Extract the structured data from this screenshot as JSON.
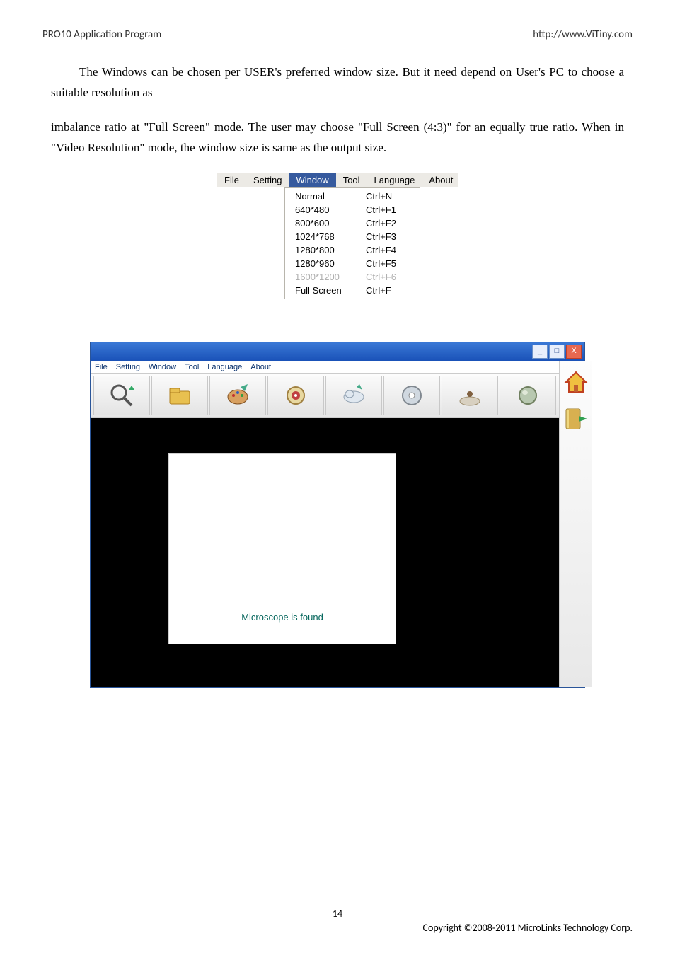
{
  "header": {
    "left": "PRO10 Application Program",
    "right": "http://www.ViTiny.com"
  },
  "para1": "The Windows can be chosen per USER's preferred window size. But it need depend on User's PC to choose a suitable resolution as",
  "para2": "imbalance ratio at \"Full Screen\" mode.   The user may choose \"Full Screen (4:3)\" for an equally true ratio.  When in \"Video Resolution\" mode, the window size is same as the output size.",
  "menubar": [
    "File",
    "Setting",
    "Window",
    "Tool",
    "Language",
    "About"
  ],
  "menubar_selected": "Window",
  "dropdown": [
    {
      "label": "Normal",
      "shortcut": "Ctrl+N",
      "disabled": false
    },
    {
      "label": "640*480",
      "shortcut": "Ctrl+F1",
      "disabled": false
    },
    {
      "label": "800*600",
      "shortcut": "Ctrl+F2",
      "disabled": false
    },
    {
      "label": "1024*768",
      "shortcut": "Ctrl+F3",
      "disabled": false
    },
    {
      "label": "1280*800",
      "shortcut": "Ctrl+F4",
      "disabled": false
    },
    {
      "label": "1280*960",
      "shortcut": "Ctrl+F5",
      "disabled": false
    },
    {
      "label": "1600*1200",
      "shortcut": "Ctrl+F6",
      "disabled": true
    },
    {
      "label": "Full Screen",
      "shortcut": "Ctrl+F",
      "disabled": false
    }
  ],
  "app_menubar": [
    "File",
    "Setting",
    "Window",
    "Tool",
    "Language",
    "About"
  ],
  "toolbar_icons": [
    "zoom-icon",
    "folder-icon",
    "palette-icon",
    "target-icon",
    "cloud-icon",
    "disc-icon",
    "down-icon",
    "sphere-icon"
  ],
  "side_icons": [
    "home-icon",
    "exit-icon"
  ],
  "popup_text": "Microscope is found",
  "page_number": "14",
  "copyright": "Copyright ©2008-2011 MicroLinks Technology Corp."
}
